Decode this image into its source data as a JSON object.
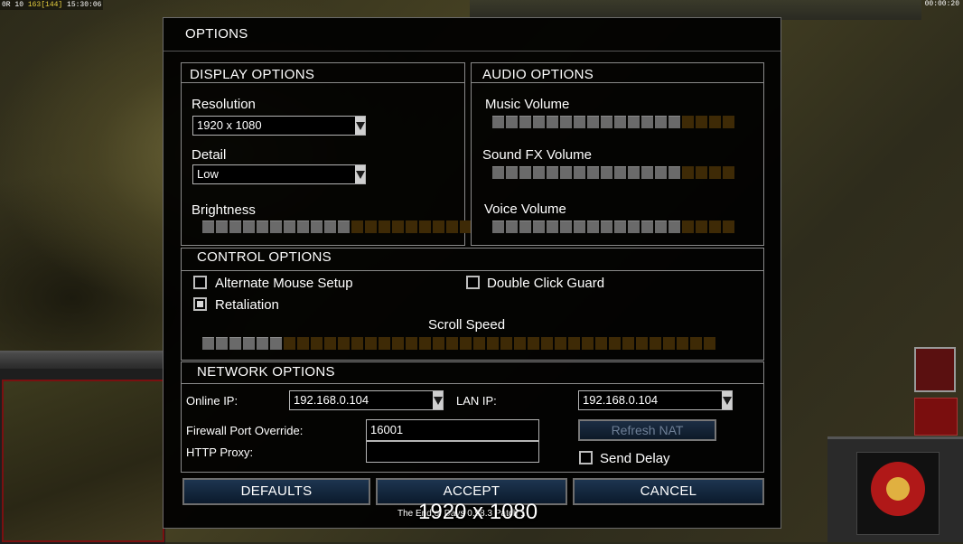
{
  "hud": {
    "left_prefix": "0R 10 ",
    "left_count": "163[144]",
    "left_time": " 15:30:06",
    "right_time": "00:00:20"
  },
  "dialog": {
    "title": "OPTIONS",
    "display": {
      "header": "DISPLAY OPTIONS",
      "resolution_label": "Resolution",
      "resolution_value": "1920 x 1080",
      "detail_label": "Detail",
      "detail_value": "Low",
      "brightness_label": "Brightness",
      "brightness_level": 0.55
    },
    "audio": {
      "header": "AUDIO OPTIONS",
      "music_label": "Music Volume",
      "music_level": 0.77,
      "sfx_label": "Sound FX Volume",
      "sfx_level": 0.77,
      "voice_label": "Voice Volume",
      "voice_level": 0.77
    },
    "control": {
      "header": "CONTROL OPTIONS",
      "alt_mouse_label": "Alternate Mouse Setup",
      "alt_mouse_checked": false,
      "double_click_label": "Double Click Guard",
      "double_click_checked": false,
      "retaliation_label": "Retaliation",
      "retaliation_checked": true,
      "scroll_label": "Scroll Speed",
      "scroll_level": 0.16
    },
    "network": {
      "header": "NETWORK OPTIONS",
      "online_ip_label": "Online IP:",
      "online_ip_value": "192.168.0.104",
      "lan_ip_label": "LAN IP:",
      "lan_ip_value": "192.168.0.104",
      "firewall_label": "Firewall Port Override:",
      "firewall_value": "16001",
      "proxy_label": "HTTP Proxy:",
      "proxy_value": "",
      "refresh_nat_label": "Refresh NAT",
      "send_delay_label": "Send Delay",
      "send_delay_checked": false
    },
    "buttons": {
      "defaults": "DEFAULTS",
      "accept": "ACCEPT",
      "cancel": "CANCEL"
    },
    "version_text": "The End of Days 0.98.3 Patch 1",
    "resolution_overlay": "1920 x 1080"
  }
}
